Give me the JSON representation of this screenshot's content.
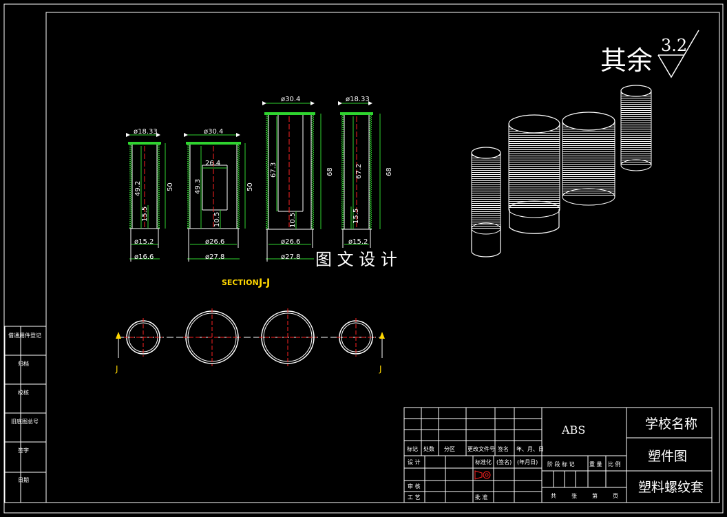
{
  "watermark": "图 文 设 计",
  "surface_finish": {
    "label": "其余",
    "value": "3.2"
  },
  "section": {
    "title": "SECTION",
    "letter": "J-J",
    "cut_label_left": "J",
    "cut_label_right": "J"
  },
  "parts": [
    {
      "top_dia": "ø18.33",
      "inner_len": "49.2",
      "thread_len": "15.5",
      "total_len": "50",
      "inner_dia": "ø15.2",
      "outer_dia": "ø16.6"
    },
    {
      "top_dia": "ø30.4",
      "bore_width": "26.4",
      "inner_len": "49.3",
      "thread_len": "10.5",
      "total_len": "50",
      "inner_dia": "ø26.6",
      "outer_dia": "ø27.8"
    },
    {
      "top_dia": "ø30.4",
      "inner_len": "67.3",
      "thread_len": "10.5",
      "total_len": "68",
      "inner_dia": "ø26.6",
      "outer_dia": "ø27.8"
    },
    {
      "top_dia": "ø18.33",
      "inner_len": "67.2",
      "thread_len": "15.5",
      "total_len": "68",
      "inner_dia": "ø15.2"
    }
  ],
  "side_column": [
    "借通用件登记",
    "归档",
    "校核",
    "旧底图总号",
    "签字",
    "日期"
  ],
  "title_block": {
    "material": "ABS",
    "school": "学校名称",
    "drawing_name": "塑件图",
    "part_name": "塑料螺纹套",
    "row_headers": [
      "标记",
      "处数",
      "分区",
      "更改文件号",
      "签名",
      "年、月、日"
    ],
    "design": "设 计",
    "standardize": "标准化",
    "sign": "(签名)",
    "date": "(年月日)",
    "review": "审 核",
    "craft": "工 艺",
    "approve": "批 准",
    "stage_headers": [
      "阶 段 标 记",
      "重 量",
      "比 例"
    ],
    "sheet": [
      "共",
      "张",
      "第",
      "页"
    ]
  }
}
